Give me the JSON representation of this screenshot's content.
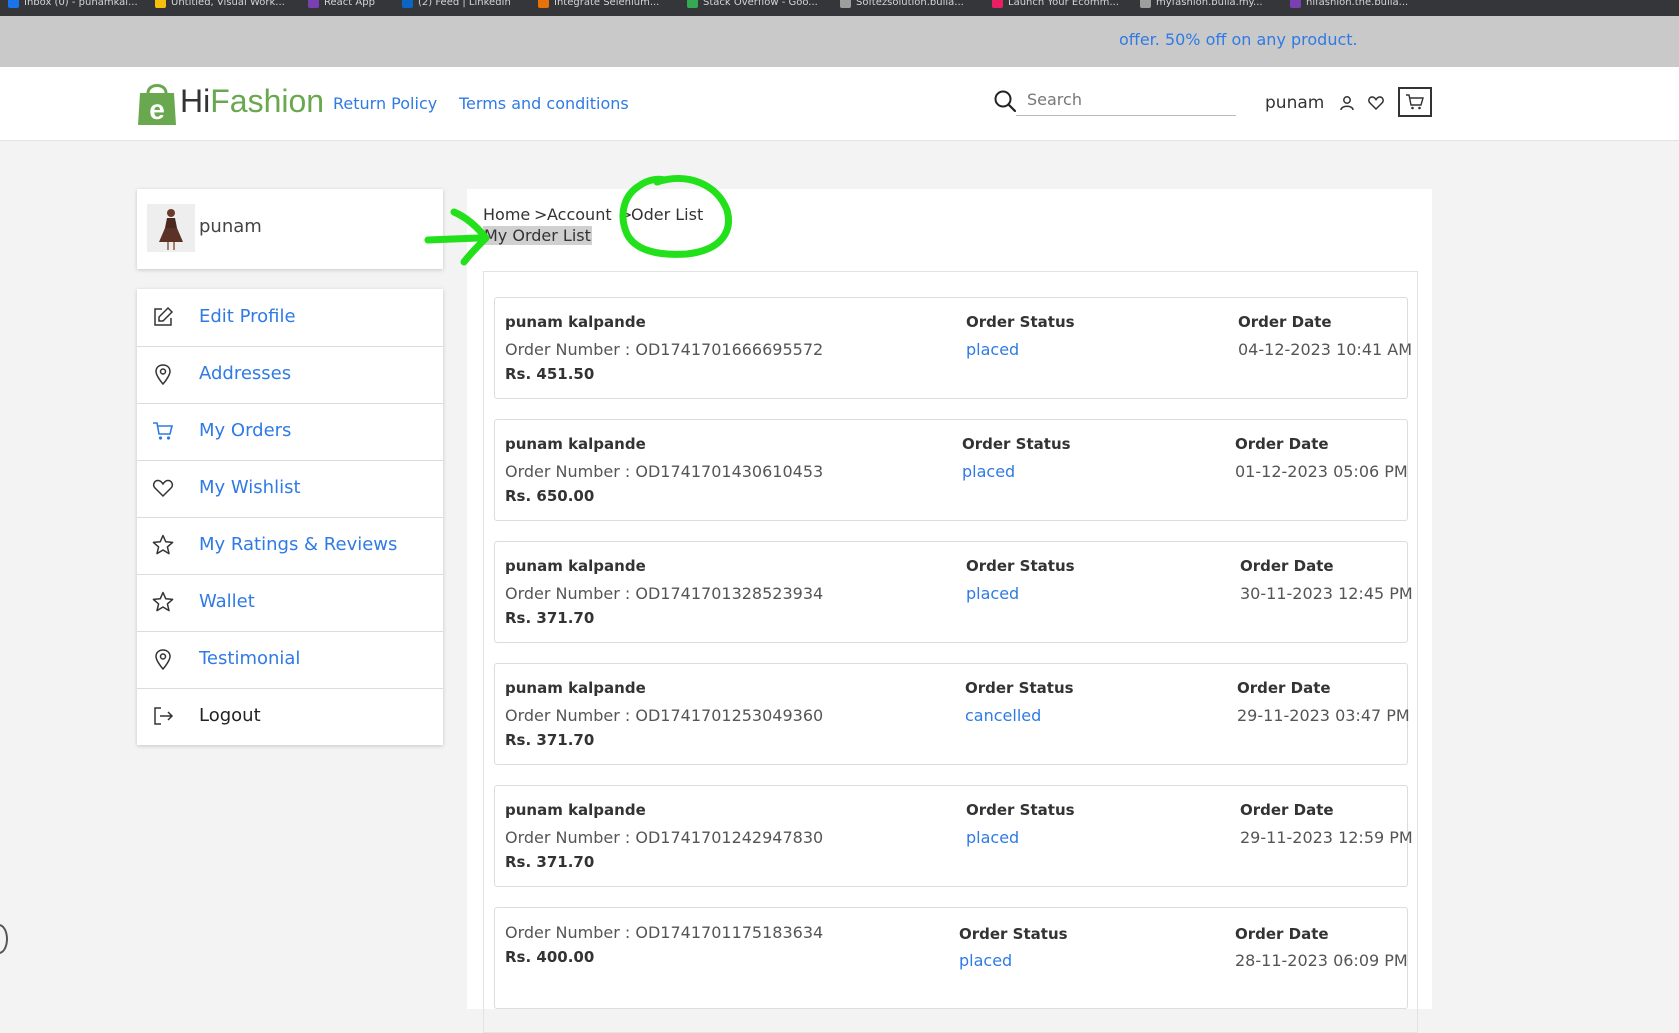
{
  "browser": {
    "bookmarks": [
      {
        "label": "Inbox (0) - punamkal...",
        "color": "#1a73e8"
      },
      {
        "label": "Untitled, Visual Work...",
        "color": "#f4c20d"
      },
      {
        "label": "React App",
        "color": "#7a3fb0"
      },
      {
        "label": "(2) Feed | LinkedIn",
        "color": "#0a66c2"
      },
      {
        "label": "Integrate Selenium...",
        "color": "#e8710a"
      },
      {
        "label": "Stack Overflow - Goo...",
        "color": "#34a853"
      },
      {
        "label": "Softezsolution.bulla...",
        "color": "#9e9e9e"
      },
      {
        "label": "Launch Your Ecomm...",
        "color": "#e91e63"
      },
      {
        "label": "myfashion.bulla.my...",
        "color": "#9e9e9e"
      },
      {
        "label": "hifashion.the.bulla...",
        "color": "#7a3fb0"
      }
    ]
  },
  "promo": {
    "text": "offer. 50% off on any product."
  },
  "header": {
    "brand_hi": "Hi",
    "brand_fashion": "Fashion",
    "nav": [
      "Return Policy",
      "Terms and conditions"
    ],
    "search_placeholder": "Search",
    "username": "punam"
  },
  "profile": {
    "name": "punam"
  },
  "sidebar": {
    "items": [
      {
        "label": "Edit Profile",
        "icon": "edit-icon"
      },
      {
        "label": "Addresses",
        "icon": "location-pin-icon"
      },
      {
        "label": "My Orders",
        "icon": "cart-icon"
      },
      {
        "label": "My Wishlist",
        "icon": "heart-icon"
      },
      {
        "label": "My Ratings & Reviews",
        "icon": "star-icon"
      },
      {
        "label": "Wallet",
        "icon": "star-icon"
      },
      {
        "label": "Testimonial",
        "icon": "location-pin-icon"
      },
      {
        "label": "Logout",
        "icon": "logout-icon"
      }
    ]
  },
  "breadcrumb": {
    "home": "Home",
    "sep1": ">",
    "account": "Account",
    "sep2": ">",
    "current": "Oder List",
    "page_title": "My Order List"
  },
  "orders": {
    "status_label": "Order Status",
    "date_label": "Order Date",
    "list": [
      {
        "customer": "punam kalpande",
        "number": "Order Number : OD1741701666695572",
        "amount": "Rs. 451.50",
        "status": "placed",
        "date": "04-12-2023 10:41 AM"
      },
      {
        "customer": "punam kalpande",
        "number": "Order Number : OD1741701430610453",
        "amount": "Rs. 650.00",
        "status": "placed",
        "date": "01-12-2023 05:06 PM"
      },
      {
        "customer": "punam kalpande",
        "number": "Order Number : OD1741701328523934",
        "amount": "Rs. 371.70",
        "status": "placed",
        "date": "30-11-2023 12:45 PM"
      },
      {
        "customer": "punam kalpande",
        "number": "Order Number : OD1741701253049360",
        "amount": "Rs. 371.70",
        "status": "cancelled",
        "date": "29-11-2023 03:47 PM"
      },
      {
        "customer": "punam kalpande",
        "number": "Order Number : OD1741701242947830",
        "amount": "Rs. 371.70",
        "status": "placed",
        "date": "29-11-2023 12:59 PM"
      },
      {
        "customer": "",
        "number": "Order Number : OD1741701175183634",
        "amount": "Rs. 400.00",
        "status": "placed",
        "date": "28-11-2023 06:09 PM"
      }
    ]
  },
  "colors": {
    "accent": "#2f7ae5",
    "brand_green": "#6aa84f",
    "annotation": "#22e01a"
  }
}
